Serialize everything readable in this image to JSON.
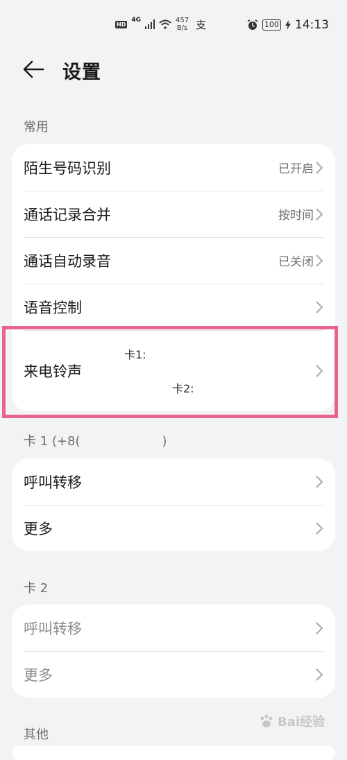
{
  "status_bar": {
    "hd": "HD",
    "network": "4G",
    "speed_top": "457",
    "speed_bottom": "B/s",
    "battery": "100",
    "time": "14:13"
  },
  "header": {
    "title": "设置"
  },
  "sections": {
    "common": "常用",
    "sim1": "卡 1 (+8(",
    "sim1_tail": ")",
    "sim2": "卡 2",
    "other": "其他"
  },
  "common_rows": [
    {
      "label": "陌生号码识别",
      "value": "已开启"
    },
    {
      "label": "通话记录合并",
      "value": "按时间"
    },
    {
      "label": "通话自动录音",
      "value": "已关闭"
    },
    {
      "label": "语音控制",
      "value": ""
    }
  ],
  "ringtone": {
    "label": "来电铃声",
    "sim1": "卡1:",
    "sim2": "卡2:"
  },
  "sim1_rows": [
    {
      "label": "呼叫转移"
    },
    {
      "label": "更多"
    }
  ],
  "sim2_rows": [
    {
      "label": "呼叫转移"
    },
    {
      "label": "更多"
    }
  ],
  "watermark": {
    "text": "Bai经验"
  },
  "colors": {
    "highlight": "#e9648b",
    "background": "#f1f3f5"
  }
}
